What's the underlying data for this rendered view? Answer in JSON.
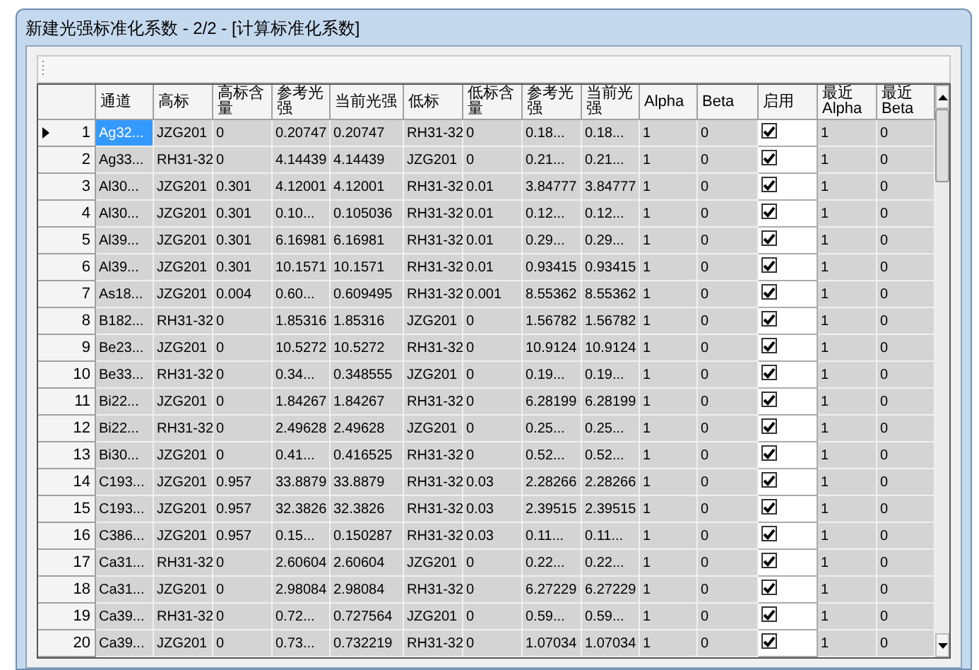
{
  "window": {
    "title": "新建光强标准化系数 - 2/2 - [计算标准化系数]"
  },
  "table": {
    "columns": [
      "通道",
      "高标",
      "高标含量",
      "参考光强",
      "当前光强",
      "低标",
      "低标含量",
      "参考光强",
      "当前光强",
      "Alpha",
      "Beta",
      "启用",
      "最近Alpha",
      "最近Beta"
    ],
    "rows": [
      {
        "number": "1",
        "selected": true,
        "enabled": true,
        "cells": [
          "Ag32...",
          "JZG201",
          "0",
          "0.20747",
          "0.20747",
          "RH31-32",
          "0",
          "0.18...",
          "0.18...",
          "1",
          "0",
          "",
          "1",
          "0"
        ]
      },
      {
        "number": "2",
        "selected": false,
        "enabled": true,
        "cells": [
          "Ag33...",
          "RH31-32",
          "0",
          "4.14439",
          "4.14439",
          "JZG201",
          "0",
          "0.21...",
          "0.21...",
          "1",
          "0",
          "",
          "1",
          "0"
        ]
      },
      {
        "number": "3",
        "selected": false,
        "enabled": true,
        "cells": [
          "Al30...",
          "JZG201",
          "0.301",
          "4.12001",
          "4.12001",
          "RH31-32",
          "0.01",
          "3.84777",
          "3.84777",
          "1",
          "0",
          "",
          "1",
          "0"
        ]
      },
      {
        "number": "4",
        "selected": false,
        "enabled": true,
        "cells": [
          "Al30...",
          "JZG201",
          "0.301",
          "0.10...",
          "0.105036",
          "RH31-32",
          "0.01",
          "0.12...",
          "0.12...",
          "1",
          "0",
          "",
          "1",
          "0"
        ]
      },
      {
        "number": "5",
        "selected": false,
        "enabled": true,
        "cells": [
          "Al39...",
          "JZG201",
          "0.301",
          "6.16981",
          "6.16981",
          "RH31-32",
          "0.01",
          "0.29...",
          "0.29...",
          "1",
          "0",
          "",
          "1",
          "0"
        ]
      },
      {
        "number": "6",
        "selected": false,
        "enabled": true,
        "cells": [
          "Al39...",
          "JZG201",
          "0.301",
          "10.1571",
          "10.1571",
          "RH31-32",
          "0.01",
          "0.93415",
          "0.93415",
          "1",
          "0",
          "",
          "1",
          "0"
        ]
      },
      {
        "number": "7",
        "selected": false,
        "enabled": true,
        "cells": [
          "As18...",
          "JZG201",
          "0.004",
          "0.60...",
          "0.609495",
          "RH31-32",
          "0.001",
          "8.55362",
          "8.55362",
          "1",
          "0",
          "",
          "1",
          "0"
        ]
      },
      {
        "number": "8",
        "selected": false,
        "enabled": true,
        "cells": [
          "B182...",
          "RH31-32",
          "0",
          "1.85316",
          "1.85316",
          "JZG201",
          "0",
          "1.56782",
          "1.56782",
          "1",
          "0",
          "",
          "1",
          "0"
        ]
      },
      {
        "number": "9",
        "selected": false,
        "enabled": true,
        "cells": [
          "Be23...",
          "JZG201",
          "0",
          "10.5272",
          "10.5272",
          "RH31-32",
          "0",
          "10.9124",
          "10.9124",
          "1",
          "0",
          "",
          "1",
          "0"
        ]
      },
      {
        "number": "10",
        "selected": false,
        "enabled": true,
        "cells": [
          "Be33...",
          "RH31-32",
          "0",
          "0.34...",
          "0.348555",
          "JZG201",
          "0",
          "0.19...",
          "0.19...",
          "1",
          "0",
          "",
          "1",
          "0"
        ]
      },
      {
        "number": "11",
        "selected": false,
        "enabled": true,
        "cells": [
          "Bi22...",
          "JZG201",
          "0",
          "1.84267",
          "1.84267",
          "RH31-32",
          "0",
          "6.28199",
          "6.28199",
          "1",
          "0",
          "",
          "1",
          "0"
        ]
      },
      {
        "number": "12",
        "selected": false,
        "enabled": true,
        "cells": [
          "Bi22...",
          "RH31-32",
          "0",
          "2.49628",
          "2.49628",
          "JZG201",
          "0",
          "0.25...",
          "0.25...",
          "1",
          "0",
          "",
          "1",
          "0"
        ]
      },
      {
        "number": "13",
        "selected": false,
        "enabled": true,
        "cells": [
          "Bi30...",
          "JZG201",
          "0",
          "0.41...",
          "0.416525",
          "RH31-32",
          "0",
          "0.52...",
          "0.52...",
          "1",
          "0",
          "",
          "1",
          "0"
        ]
      },
      {
        "number": "14",
        "selected": false,
        "enabled": true,
        "cells": [
          "C193...",
          "JZG201",
          "0.957",
          "33.8879",
          "33.8879",
          "RH31-32",
          "0.03",
          "2.28266",
          "2.28266",
          "1",
          "0",
          "",
          "1",
          "0"
        ]
      },
      {
        "number": "15",
        "selected": false,
        "enabled": true,
        "cells": [
          "C193...",
          "JZG201",
          "0.957",
          "32.3826",
          "32.3826",
          "RH31-32",
          "0.03",
          "2.39515",
          "2.39515",
          "1",
          "0",
          "",
          "1",
          "0"
        ]
      },
      {
        "number": "16",
        "selected": false,
        "enabled": true,
        "cells": [
          "C386...",
          "JZG201",
          "0.957",
          "0.15...",
          "0.150287",
          "RH31-32",
          "0.03",
          "0.11...",
          "0.11...",
          "1",
          "0",
          "",
          "1",
          "0"
        ]
      },
      {
        "number": "17",
        "selected": false,
        "enabled": true,
        "cells": [
          "Ca31...",
          "RH31-32",
          "0",
          "2.60604",
          "2.60604",
          "JZG201",
          "0",
          "0.22...",
          "0.22...",
          "1",
          "0",
          "",
          "1",
          "0"
        ]
      },
      {
        "number": "18",
        "selected": false,
        "enabled": true,
        "cells": [
          "Ca31...",
          "JZG201",
          "0",
          "2.98084",
          "2.98084",
          "RH31-32",
          "0",
          "6.27229",
          "6.27229",
          "1",
          "0",
          "",
          "1",
          "0"
        ]
      },
      {
        "number": "19",
        "selected": false,
        "enabled": true,
        "cells": [
          "Ca39...",
          "RH31-32",
          "0",
          "0.72...",
          "0.727564",
          "JZG201",
          "0",
          "0.59...",
          "0.59...",
          "1",
          "0",
          "",
          "1",
          "0"
        ]
      },
      {
        "number": "20",
        "selected": false,
        "enabled": true,
        "cells": [
          "Ca39...",
          "JZG201",
          "0",
          "0.73...",
          "0.732219",
          "RH31-32",
          "0",
          "1.07034",
          "1.07034",
          "1",
          "0",
          "",
          "1",
          "0"
        ]
      }
    ]
  }
}
